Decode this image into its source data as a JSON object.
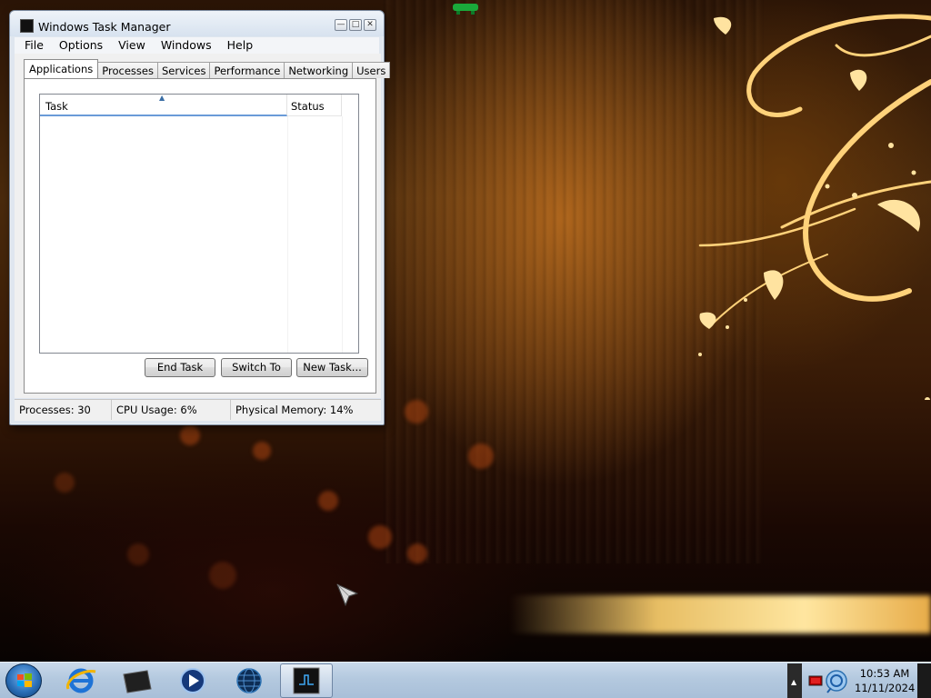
{
  "window": {
    "title": "Windows Task Manager",
    "menu": [
      "File",
      "Options",
      "View",
      "Windows",
      "Help"
    ],
    "tabs": [
      "Applications",
      "Processes",
      "Services",
      "Performance",
      "Networking",
      "Users"
    ],
    "active_tab": "Applications",
    "list": {
      "columns": [
        "Task",
        "Status"
      ],
      "rows": []
    },
    "buttons": {
      "end_task": "End Task",
      "switch_to": "Switch To",
      "new_task": "New Task..."
    },
    "status": {
      "processes": "Processes: 30",
      "cpu": "CPU Usage: 6%",
      "memory": "Physical Memory: 14%"
    }
  },
  "taskbar": {
    "pinned_icons": [
      "internet-explorer-icon",
      "file-explorer-icon",
      "media-player-icon",
      "network-globe-icon",
      "task-manager-icon"
    ],
    "clock": {
      "time": "10:53 AM",
      "date": "11/11/2024"
    }
  },
  "colors": {
    "title_bar": "#d7e2ef",
    "taskbar": "#b4c9df",
    "sort_accent": "#6a9bd8"
  }
}
